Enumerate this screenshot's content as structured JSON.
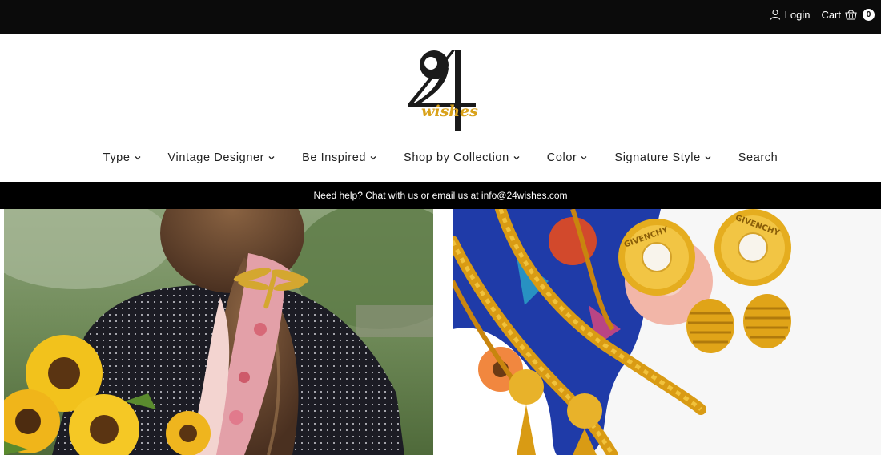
{
  "topbar": {
    "login_label": "Login",
    "cart_label": "Cart",
    "cart_count": "0"
  },
  "logo": {
    "number": "24",
    "script": "wishes"
  },
  "nav": {
    "items": [
      {
        "label": "Type",
        "has_dropdown": true
      },
      {
        "label": "Vintage Designer",
        "has_dropdown": true
      },
      {
        "label": "Be Inspired",
        "has_dropdown": true
      },
      {
        "label": "Shop by Collection",
        "has_dropdown": true
      },
      {
        "label": "Color",
        "has_dropdown": true
      },
      {
        "label": "Signature Style",
        "has_dropdown": true
      },
      {
        "label": "Search",
        "has_dropdown": false
      }
    ]
  },
  "helpbar": {
    "text": "Need help? Chat with us or email us at info@24wishes.com"
  },
  "hero": {
    "right_brand_text": "GIVENCHY"
  },
  "colors": {
    "topbar_bg": "#0b0b0b",
    "helpbar_bg": "#000000",
    "logo_gold": "#d9a21a",
    "logo_black": "#1a1a1a"
  },
  "icons": [
    "user-icon",
    "cart-icon",
    "chevron-down-icon"
  ]
}
